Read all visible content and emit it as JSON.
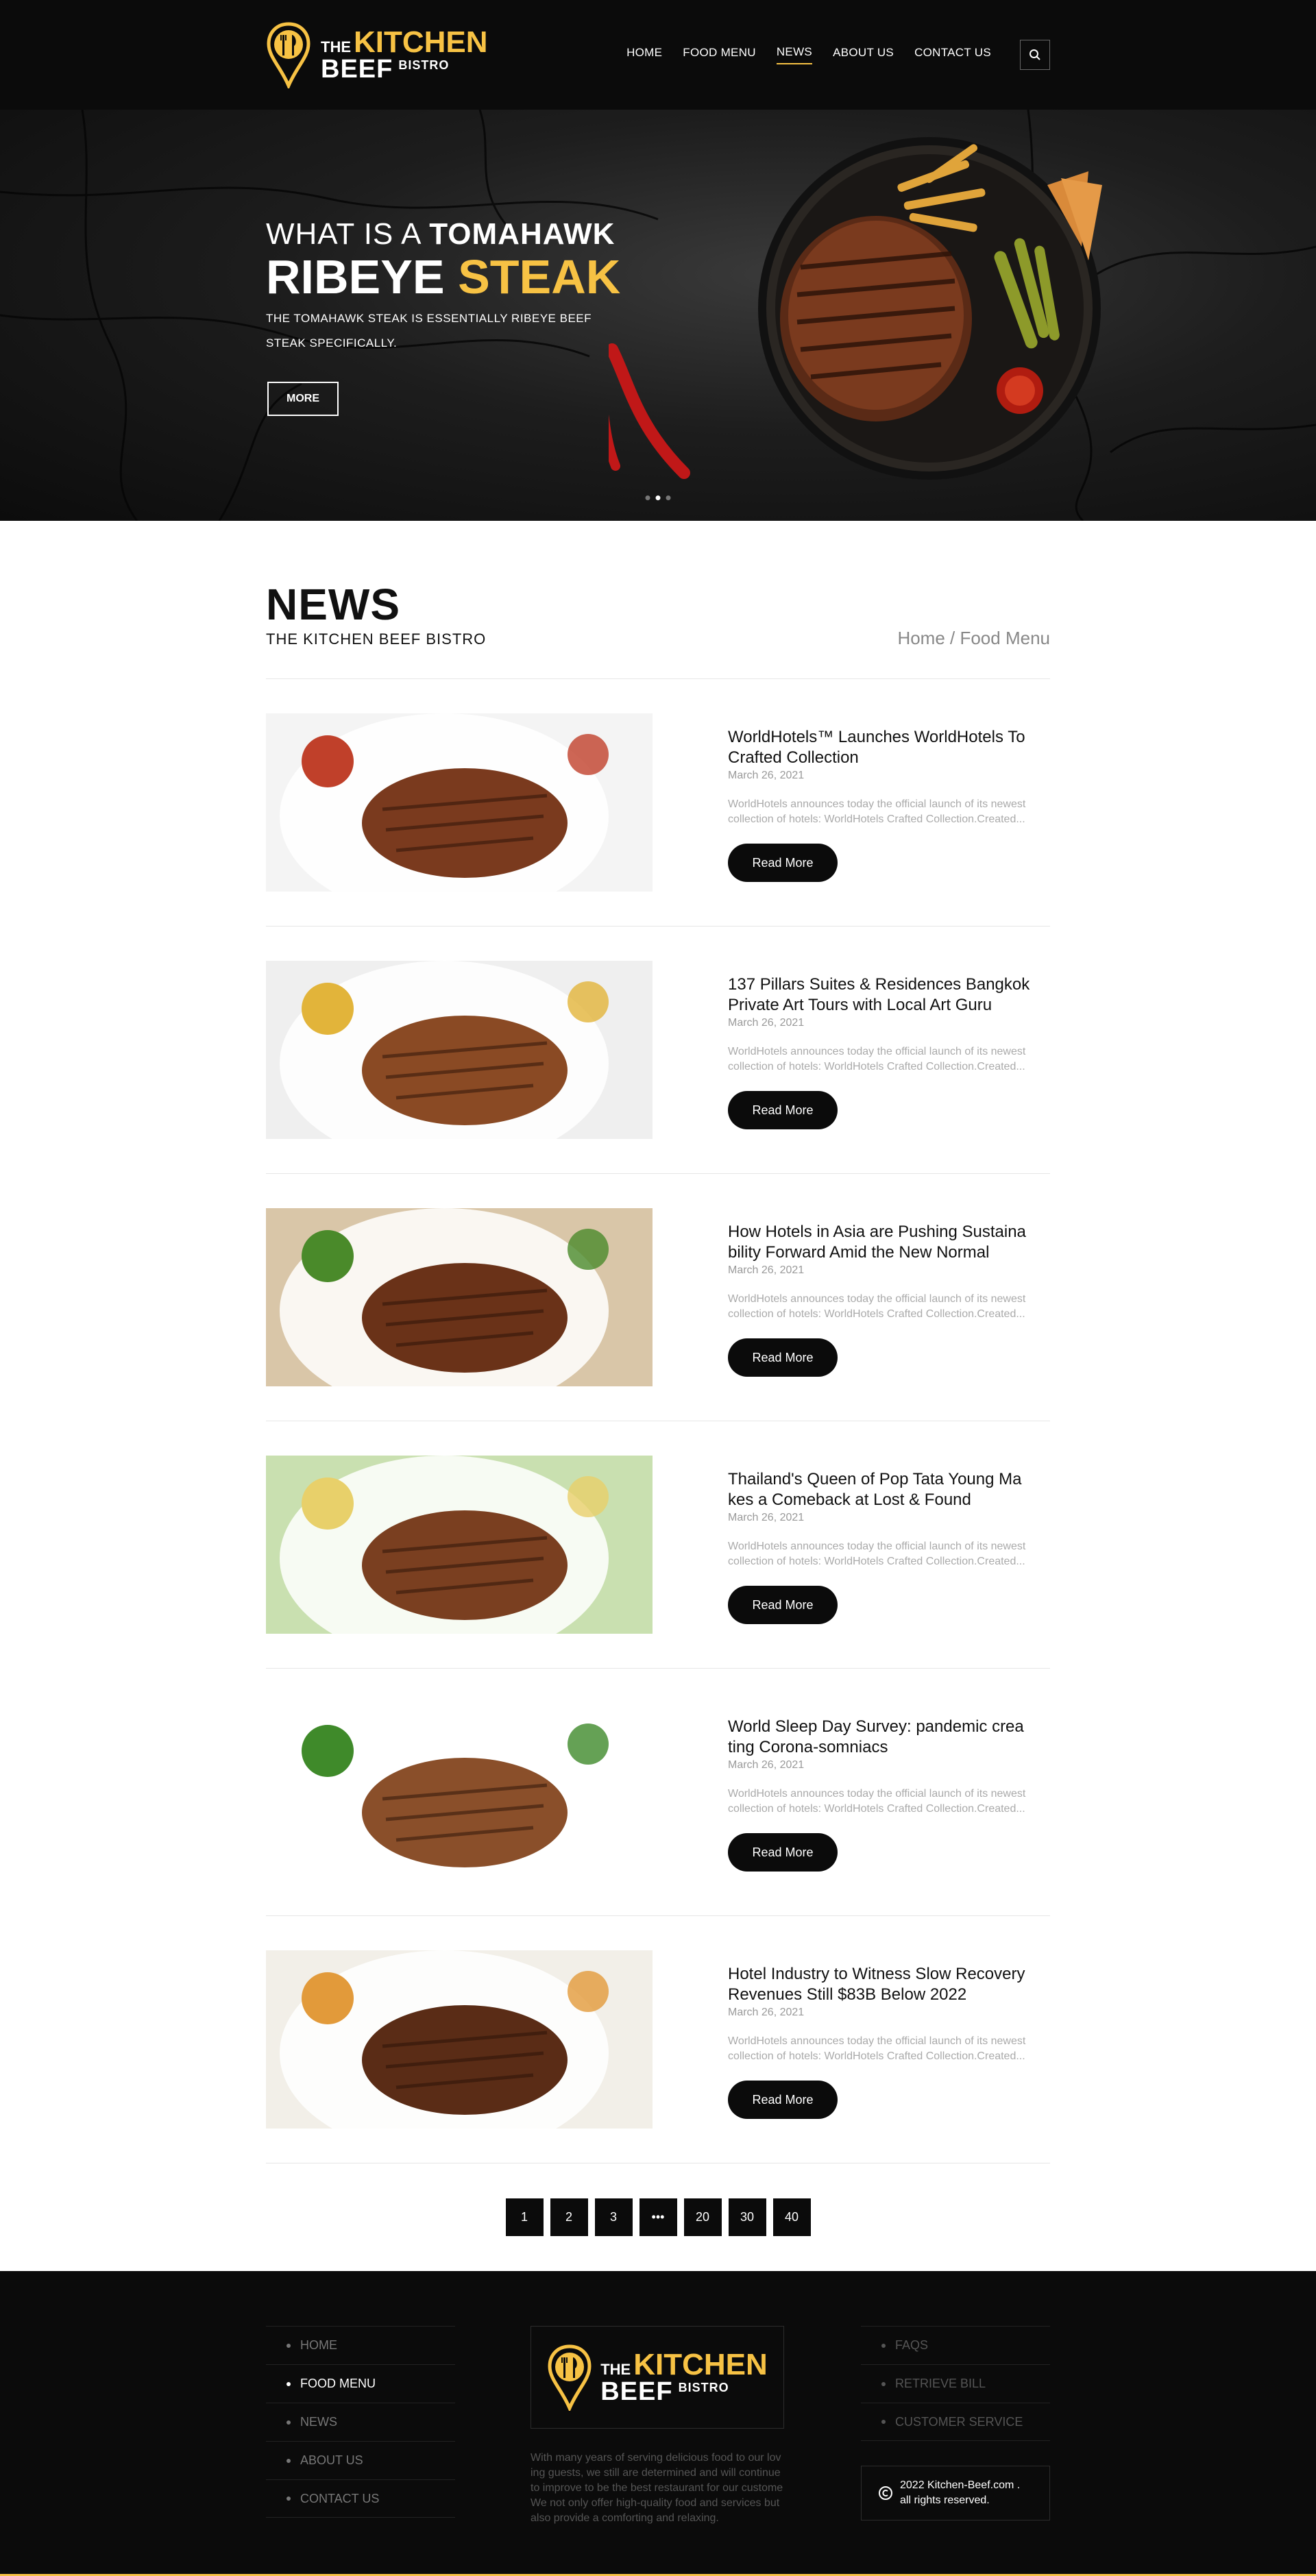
{
  "brand": {
    "the": "THE",
    "kitchen": "KITCHEN",
    "beef": "BEEF",
    "bistro": "BISTRO"
  },
  "nav": [
    {
      "label": "HOME",
      "active": false
    },
    {
      "label": "FOOD MENU",
      "active": false
    },
    {
      "label": "NEWS",
      "active": true
    },
    {
      "label": "ABOUT US",
      "active": false
    },
    {
      "label": "CONTACT US",
      "active": false
    }
  ],
  "colors": {
    "accent": "#f7c244",
    "dark": "#0b0b0b"
  },
  "hero": {
    "line1_light": "WHAT IS A",
    "line1_bold": "TOMAHAWK",
    "line2_white": "RIBEYE",
    "line2_yellow": "STEAK",
    "desc": "THE TOMAHAWK STEAK IS ESSENTIALLY RIBEYE BEEF STEAK SPECIFICALLY.",
    "more": "MORE",
    "slides": 3,
    "active_slide": 2
  },
  "news": {
    "title": "NEWS",
    "subtitle": "THE KITCHEN BEEF BISTRO",
    "breadcrumb": "Home / Food Menu",
    "read_more": "Read More",
    "items": [
      {
        "title": "WorldHotels™ Launches WorldHotels To Crafted Collection",
        "date": "March 26, 2021",
        "excerpt": "WorldHotels announces today the official launch of its newest collection of hotels: WorldHotels Crafted Collection.Created..."
      },
      {
        "title": "137 Pillars Suites & Residences Bangkok Private Art Tours with Local Art Guru",
        "date": "March 26, 2021",
        "excerpt": "WorldHotels announces today the official launch of its newest collection of hotels: WorldHotels Crafted Collection.Created..."
      },
      {
        "title": "How Hotels in Asia are Pushing Sustaina bility Forward Amid the New Normal",
        "date": "March 26, 2021",
        "excerpt": "WorldHotels announces today the official launch of its newest collection of hotels: WorldHotels Crafted Collection.Created..."
      },
      {
        "title": "Thailand's Queen of Pop Tata Young Ma kes a Comeback at Lost & Found",
        "date": "March 26, 2021",
        "excerpt": "WorldHotels announces today the official launch of its newest collection of hotels: WorldHotels Crafted Collection.Created..."
      },
      {
        "title": "World Sleep Day Survey: pandemic crea ting Corona-somniacs",
        "date": "March 26, 2021",
        "excerpt": "WorldHotels announces today the official launch of its newest collection of hotels: WorldHotels Crafted Collection.Created..."
      },
      {
        "title": "Hotel Industry to Witness Slow Recovery Revenues Still $83B Below 2022",
        "date": "March 26, 2021",
        "excerpt": "WorldHotels announces today the official launch of its newest collection of hotels: WorldHotels Crafted Collection.Created..."
      }
    ]
  },
  "pagination": [
    "1",
    "2",
    "3",
    "•••",
    "20",
    "30",
    "40"
  ],
  "footer": {
    "links_left": [
      "HOME",
      "FOOD MENU",
      "NEWS",
      "ABOUT US",
      "CONTACT US"
    ],
    "links_left_active": "FOOD MENU",
    "links_right": [
      "FAQS",
      "RETRIEVE BILL",
      "CUSTOMER SERVICE"
    ],
    "about": "With many years of serving delicious food to our lov ing guests, we still are determined and will continue to improve to be the best restaurant for our custome We not only offer high-quality food and services but also provide a comforting and relaxing.",
    "copyright_line1": "2022 Kitchen-Beef.com .",
    "copyright_line2": "all rights reserved.",
    "copyright_symbol": "©"
  }
}
